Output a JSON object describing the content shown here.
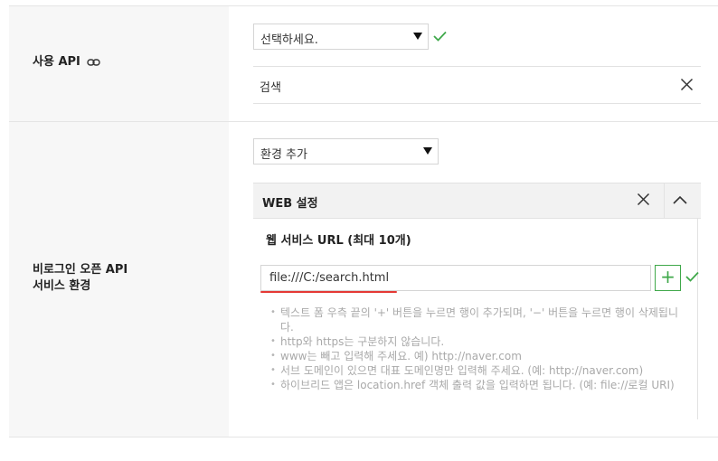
{
  "rows": {
    "api": {
      "label": "사용 API",
      "select_value": "선택하세요.",
      "search_text": "검색"
    },
    "env": {
      "label_line1": "비로그인 오픈 API",
      "label_line2": "서비스 환경",
      "select_value": "환경 추가",
      "web_panel": {
        "title": "WEB 설정",
        "url_title": "웹 서비스 URL (최대 10개)",
        "url_value": "file:///C:/search.html",
        "plus_label": "+",
        "notes": [
          "텍스트 폼 우측 끝의 '+' 버튼을 누르면 행이 추가되며, '−' 버튼을 누르면 행이 삭제됩니다.",
          "http와 https는 구분하지 않습니다.",
          "www는 빼고 입력해 주세요. 예) http://naver.com",
          "서브 도메인이 있으면 대표 도메인명만 입력해 주세요. (예: http://naver.com)",
          "하이브리드 앱은 location.href 객체 출력 값을 입력하면 됩니다. (예: file://로컬 URI)"
        ]
      }
    }
  },
  "colors": {
    "label_bg": "#f7f7f7",
    "accent_green": "#3fa84a",
    "underline_red": "#e53935",
    "note_text": "#a9a9a9"
  },
  "icons": [
    "link-icon",
    "check-icon",
    "close-icon",
    "chevron-up-icon",
    "plus-icon",
    "dropdown-arrow-icon"
  ]
}
